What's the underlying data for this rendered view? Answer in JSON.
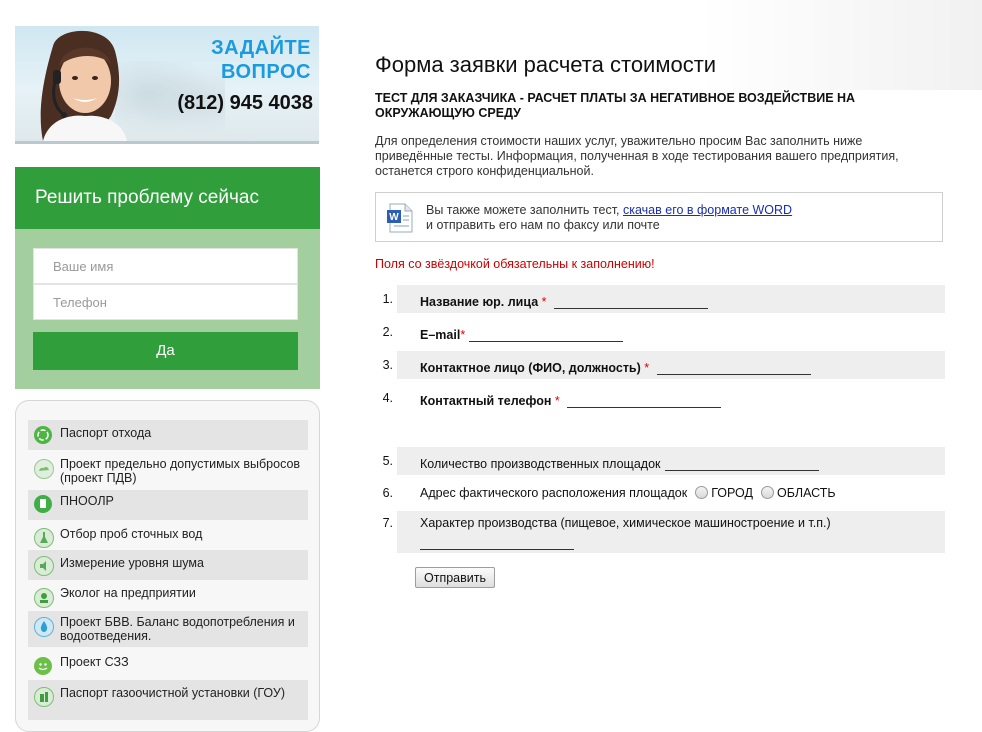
{
  "banner": {
    "ask_line1": "ЗАДАЙТЕ",
    "ask_line2": "ВОПРОС",
    "phone": "(812) 945 4038"
  },
  "quick_form": {
    "title": "Решить проблему сейчас",
    "name_placeholder": "Ваше имя",
    "phone_placeholder": "Телефон",
    "button": "Да"
  },
  "services": [
    {
      "label": "Паспорт отхода",
      "icon": "recycle-icon"
    },
    {
      "label": "Проект предельно допустимых выбросов (проект ПДВ)",
      "icon": "cloud-icon"
    },
    {
      "label": "ПНООЛР",
      "icon": "document-icon"
    },
    {
      "label": "Отбор проб сточных вод",
      "icon": "flask-icon"
    },
    {
      "label": "Измерение уровня шума",
      "icon": "sound-icon"
    },
    {
      "label": "Эколог на предприятии",
      "icon": "eco-person-icon"
    },
    {
      "label": "Проект БВВ. Баланс водопотребления и водоотведения.",
      "icon": "water-drop-icon"
    },
    {
      "label": "Проект СЗЗ",
      "icon": "smiley-icon"
    },
    {
      "label": "Паспорт газоочистной установки (ГОУ)",
      "icon": "gas-icon"
    }
  ],
  "main": {
    "title": "Форма заявки расчета стоимости",
    "subtitle": "ТЕСТ ДЛЯ ЗАКАЗЧИКА - РАСЧЕТ ПЛАТЫ ЗА НЕГАТИВНОЕ ВОЗДЕЙСТВИЕ НА ОКРУЖАЮЩУЮ СРЕДУ",
    "intro": "Для определения стоимости наших услуг, уважительно просим Вас заполнить ниже приведённые тесты. Информация, полученная в ходе тестирования вашего предприятия, останется строго конфиденциальной.",
    "word_prefix": "Вы также можете заполнить тест, ",
    "word_link": "скачав его в формате WORD",
    "word_suffix": "и отправить его нам по факсу или почте",
    "required_note": "Поля со звёздочкой обязательны к заполнению!",
    "fields": [
      {
        "num": "1.",
        "label": "Название юр. лица",
        "required": "*"
      },
      {
        "num": "2.",
        "label": "E–mail",
        "required": "*"
      },
      {
        "num": "3.",
        "label": "Контактное лицо (ФИО, должность)",
        "required": "*"
      },
      {
        "num": "4.",
        "label": "Контактный телефон",
        "required": "*"
      },
      {
        "num": "5.",
        "label": "Количество производственных площадок"
      },
      {
        "num": "6.",
        "label": "Адрес фактического расположения площадок",
        "options": [
          "ГОРОД",
          "ОБЛАСТЬ"
        ]
      },
      {
        "num": "7.",
        "label": "Характер производства (пищевое, химическое машиностроение и т.п.)"
      }
    ],
    "submit": "Отправить"
  }
}
